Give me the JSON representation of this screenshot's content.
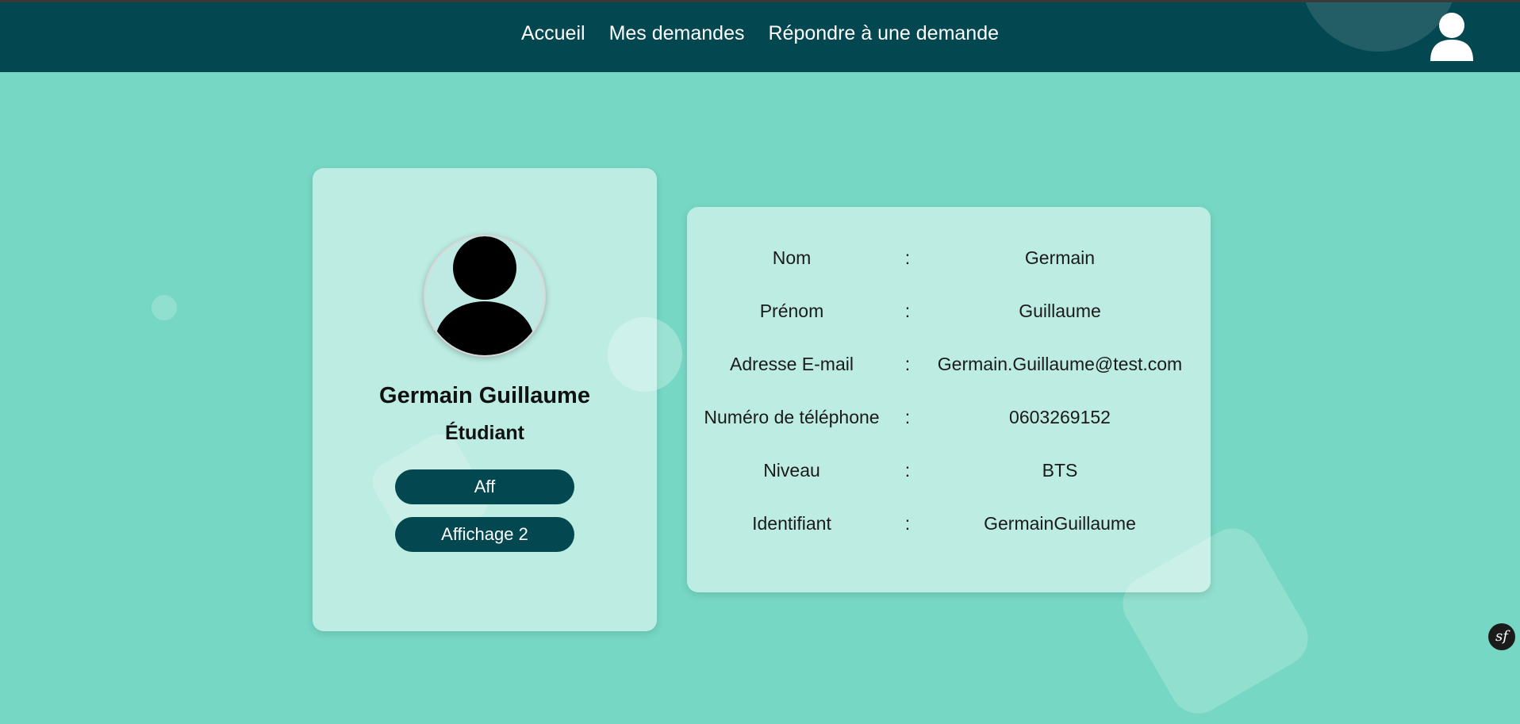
{
  "navbar": {
    "links": [
      "Accueil",
      "Mes demandes",
      "Répondre à une demande"
    ],
    "user_icon": "user-icon"
  },
  "profile": {
    "full_name": "Germain Guillaume",
    "role": "Étudiant",
    "avatar_icon": "avatar-icon",
    "buttons": [
      "Aff",
      "Affichage 2"
    ]
  },
  "info": {
    "separator": ":",
    "rows": [
      {
        "label": "Nom",
        "value": "Germain"
      },
      {
        "label": "Prénom",
        "value": "Guillaume"
      },
      {
        "label": "Adresse E-mail",
        "value": "Germain.Guillaume@test.com"
      },
      {
        "label": "Numéro de téléphone",
        "value": "0603269152"
      },
      {
        "label": "Niveau",
        "value": "BTS"
      },
      {
        "label": "Identifiant",
        "value": "GermainGuillaume"
      }
    ]
  },
  "debug_toolbar": {
    "label": "sf",
    "icon": "symfony-icon"
  },
  "colors": {
    "navbar": "#034750",
    "background": "#76d7c4",
    "button": "#034750",
    "card": "#bbeae3"
  }
}
